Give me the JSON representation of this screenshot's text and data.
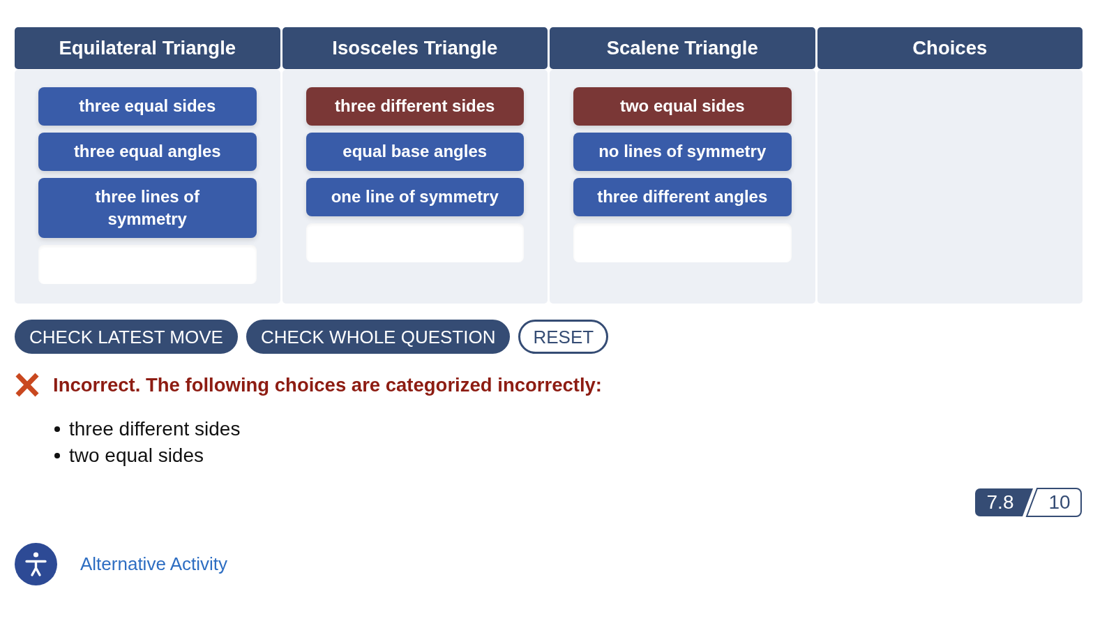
{
  "categories": [
    {
      "title": "Equilateral Triangle",
      "items": [
        {
          "label": "three equal sides",
          "correct": true
        },
        {
          "label": "three equal angles",
          "correct": true
        },
        {
          "label": "three lines of symmetry",
          "correct": true
        }
      ],
      "drop_slot": true
    },
    {
      "title": "Isosceles Triangle",
      "items": [
        {
          "label": "three different sides",
          "correct": false
        },
        {
          "label": "equal base angles",
          "correct": true
        },
        {
          "label": "one line of symmetry",
          "correct": true
        }
      ],
      "drop_slot": true
    },
    {
      "title": "Scalene Triangle",
      "items": [
        {
          "label": "two equal sides",
          "correct": false
        },
        {
          "label": "no lines of symmetry",
          "correct": true
        },
        {
          "label": "three different angles",
          "correct": true
        }
      ],
      "drop_slot": true
    },
    {
      "title": "Choices"
    }
  ],
  "buttons": [
    {
      "label": "CHECK LATEST MOVE",
      "kind": "filled"
    },
    {
      "label": "CHECK WHOLE QUESTION",
      "kind": "filled"
    },
    {
      "label": "RESET",
      "kind": "outline"
    }
  ],
  "feedback": {
    "correct": false,
    "message": "Incorrect. The following choices are categorized incorrectly:",
    "items": [
      "three different sides",
      "two equal sides"
    ]
  },
  "score": {
    "earned": "7.8",
    "total": "10"
  },
  "footer": {
    "link": "Alternative Activity"
  }
}
